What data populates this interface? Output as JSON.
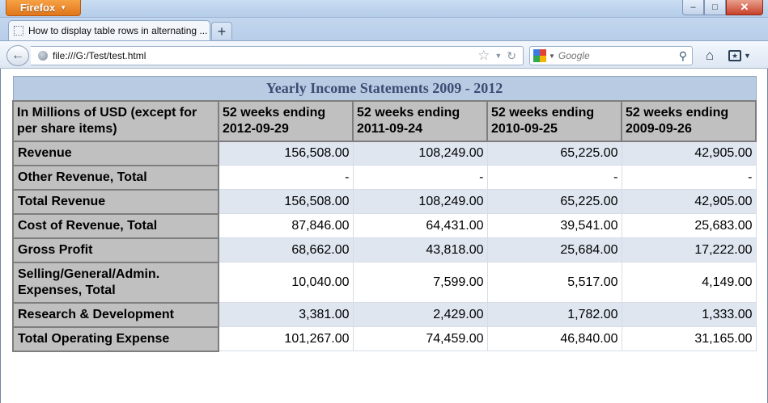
{
  "browser": {
    "menu_label": "Firefox",
    "tab_title": "How to display table rows in alternating ...",
    "new_tab_label": "+",
    "url": "file:///G:/Test/test.html",
    "search_placeholder": "Google",
    "window_controls": {
      "minimize": "–",
      "maximize": "□",
      "close": "✕"
    },
    "icons": [
      "back-arrow-icon",
      "globe-icon",
      "bookmark-star-icon",
      "history-dropdown-icon",
      "reload-icon",
      "google-logo-icon",
      "search-magnifier-icon",
      "home-icon",
      "bookmarks-menu-icon"
    ]
  },
  "table": {
    "caption": "Yearly Income Statements 2009 - 2012",
    "header_line1": [
      "In Millions of USD (except for",
      "52 weeks ending",
      "52 weeks ending",
      "52 weeks ending",
      "52 weeks ending"
    ],
    "header_line2": [
      "per share items)",
      "2012-09-29",
      "2011-09-24",
      "2010-09-25",
      "2009-09-26"
    ],
    "rows": [
      {
        "label": "Revenue",
        "values": [
          "156,508.00",
          "108,249.00",
          "65,225.00",
          "42,905.00"
        ]
      },
      {
        "label": "Other Revenue, Total",
        "values": [
          "-",
          "-",
          "-",
          "-"
        ]
      },
      {
        "label": "Total Revenue",
        "values": [
          "156,508.00",
          "108,249.00",
          "65,225.00",
          "42,905.00"
        ]
      },
      {
        "label": "Cost of Revenue, Total",
        "values": [
          "87,846.00",
          "64,431.00",
          "39,541.00",
          "25,683.00"
        ]
      },
      {
        "label": "Gross Profit",
        "values": [
          "68,662.00",
          "43,818.00",
          "25,684.00",
          "17,222.00"
        ]
      },
      {
        "label_line1": "Selling/General/Admin.",
        "label_line2": "Expenses, Total",
        "values": [
          "10,040.00",
          "7,599.00",
          "5,517.00",
          "4,149.00"
        ]
      },
      {
        "label": "Research & Development",
        "values": [
          "3,381.00",
          "2,429.00",
          "1,782.00",
          "1,333.00"
        ]
      },
      {
        "label": "Total Operating Expense",
        "values": [
          "101,267.00",
          "74,459.00",
          "46,840.00",
          "31,165.00"
        ]
      }
    ]
  },
  "colors": {
    "caption_bg": "#b9cbe3",
    "caption_text": "#3b4d73",
    "header_bg": "#c0c0c0",
    "alt_row_bg": "#dfe6f0",
    "plain_row_bg": "#ffffff",
    "firefox_button": "#e0761a"
  }
}
